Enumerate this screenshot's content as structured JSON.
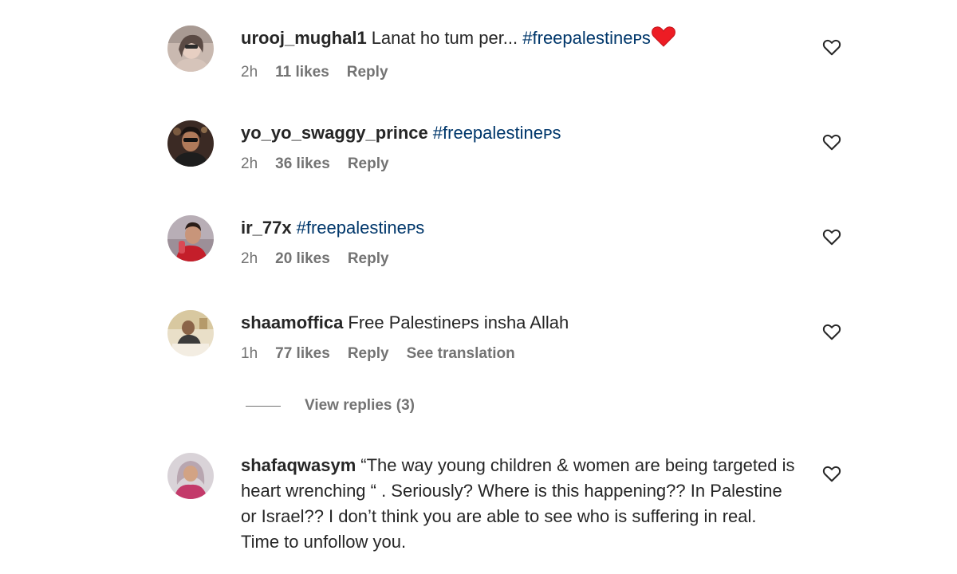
{
  "comments": [
    {
      "username": "urooj_mughal1",
      "text": "Lanat ho tum per... ",
      "hashtag": "#freepalestineᴘs",
      "time": "2h",
      "likes": "11 likes",
      "reply": "Reply"
    },
    {
      "username": "yo_yo_swaggy_prince",
      "text": "",
      "hashtag": "#freepalestineᴘs",
      "time": "2h",
      "likes": "36 likes",
      "reply": "Reply"
    },
    {
      "username": "ir_77x",
      "text": "",
      "hashtag": "#freepalestineᴘs",
      "time": "2h",
      "likes": "20 likes",
      "reply": "Reply"
    },
    {
      "username": "shaamoffica",
      "text": "Free Palestineᴘs insha Allah",
      "time": "1h",
      "likes": "77 likes",
      "reply": "Reply",
      "translation": "See translation"
    },
    {
      "username": "shafaqwasym",
      "text": "“The way young children & women are being targeted is heart wrenching “ . Seriously? Where is this happening?? In Palestine or Israel?? I don’t think you are able to see who is suffering in real.",
      "text2": "Time to unfollow you."
    }
  ],
  "view_replies": "View replies (3)",
  "colors": {
    "hashtag": "#00376b",
    "meta": "#737373",
    "heart": "#ed1c24"
  }
}
